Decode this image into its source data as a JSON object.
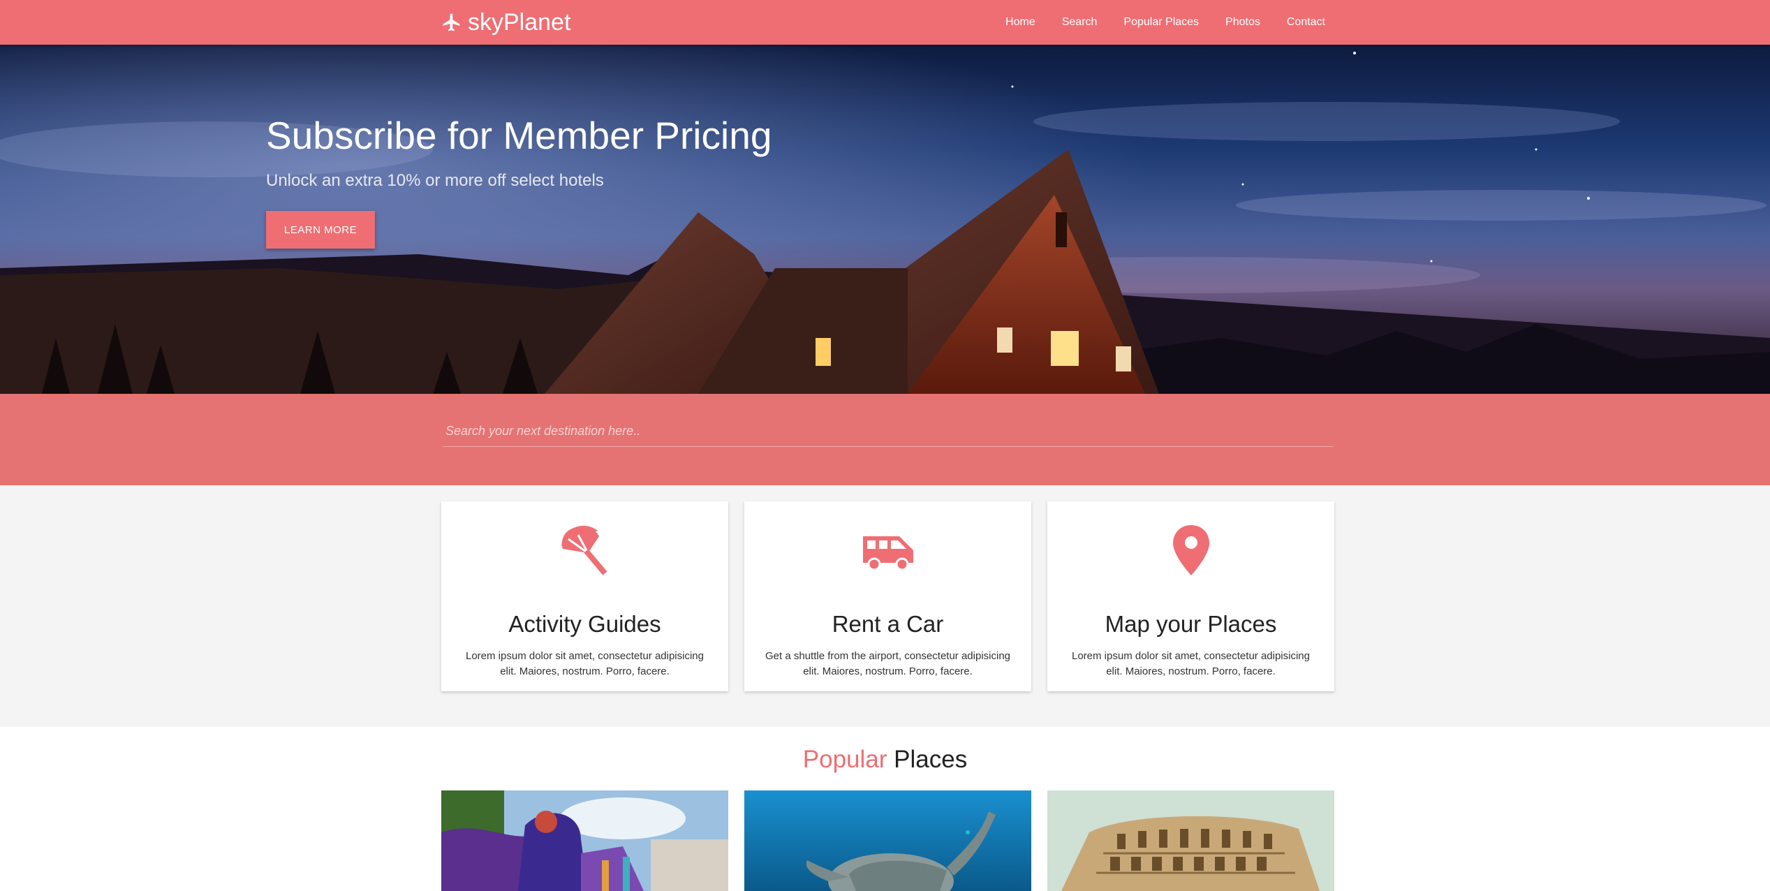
{
  "navbar": {
    "brand": "skyPlanet",
    "links": [
      "Home",
      "Search",
      "Popular Places",
      "Photos",
      "Contact"
    ]
  },
  "hero": {
    "title": "Subscribe for Member Pricing",
    "subtitle": "Unlock an extra 10% or more off select hotels",
    "button": "LEARN MORE"
  },
  "search": {
    "placeholder": "Search your next destination here.."
  },
  "features": [
    {
      "icon": "beach-umbrella-icon",
      "title": "Activity Guides",
      "text": "Lorem ipsum dolor sit amet, consectetur adipisicing elit. Maiores, nostrum. Porro, facere."
    },
    {
      "icon": "shuttle-van-icon",
      "title": "Rent a Car",
      "text": "Get a shuttle from the airport, consectetur adipisicing elit. Maiores, nostrum. Porro, facere."
    },
    {
      "icon": "map-pin-icon",
      "title": "Map your Places",
      "text": "Lorem ipsum dolor sit amet, consectetur adipisicing elit. Maiores, nostrum. Porro, facere."
    }
  ],
  "popular": {
    "title_accent": "Popular",
    "title_rest": "Places"
  },
  "colors": {
    "primary": "#ee6e73",
    "search_band": "#e57373",
    "features_bg": "#f4f4f4"
  }
}
